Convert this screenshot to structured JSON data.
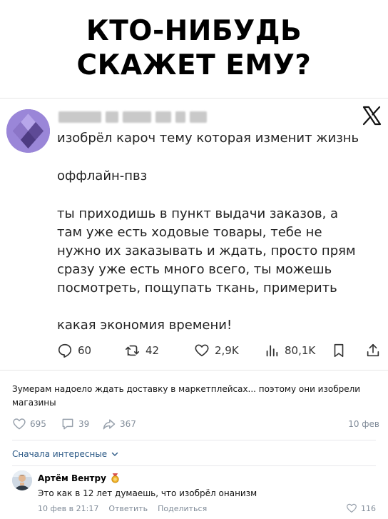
{
  "meme": {
    "line1": "КТО-НИБУДЬ",
    "line2": "СКАЖЕТ ЕМУ?"
  },
  "tweet": {
    "text_line1": "изобрёл кароч тему которая изменит жизнь",
    "text_line2": "оффлайн-пвз",
    "text_para3": "ты приходишь в пункт выдачи заказов, а там уже есть ходовые товары, тебе не нужно их заказывать и ждать, просто прям сразу уже есть много всего, ты можешь посмотреть, пощупать ткань, примерить",
    "text_line4": "какая экономия времени!",
    "metrics": {
      "replies": "60",
      "retweets": "42",
      "likes": "2,9K",
      "views": "80,1K"
    },
    "icons": [
      "x-logo-icon",
      "reply-icon",
      "retweet-icon",
      "heart-icon",
      "views-icon",
      "bookmark-icon",
      "share-icon"
    ]
  },
  "post": {
    "caption": "Зумерам надоело ждать доставку в маркетплейсах... поэтому они изобрели магазины",
    "likes": "695",
    "comments": "39",
    "shares": "367",
    "date": "10 фев"
  },
  "comments_section": {
    "sort_label": "Сначала интересные",
    "comment": {
      "author": "Артём Вентру",
      "text": "Это как в 12 лет думаешь, что изобрёл онанизм",
      "date": "10 фев в 21:17",
      "reply_label": "Ответить",
      "share_label": "Поделиться",
      "likes": "116"
    }
  },
  "colors": {
    "vk_link": "#2a5885",
    "vk_meta": "#818c99",
    "avatar_purple": "#8f78d0"
  }
}
